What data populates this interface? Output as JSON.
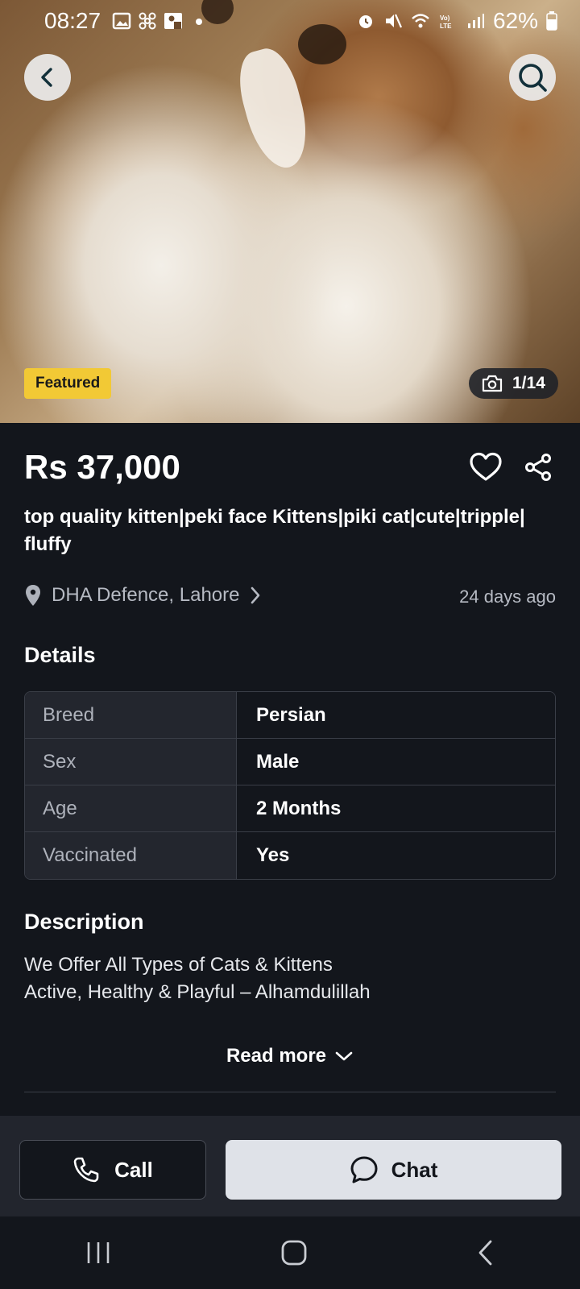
{
  "status_bar": {
    "time": "08:27",
    "battery": "62%"
  },
  "hero": {
    "featured_label": "Featured",
    "photo_count": "1/14"
  },
  "listing": {
    "price": "Rs 37,000",
    "title": "top quality kitten|peki face Kittens|piki cat|cute|tripple| fluffy",
    "location": "DHA Defence, Lahore",
    "posted": "24 days ago"
  },
  "details": {
    "heading": "Details",
    "rows": [
      {
        "key": "Breed",
        "value": "Persian"
      },
      {
        "key": "Sex",
        "value": "Male"
      },
      {
        "key": "Age",
        "value": "2 Months"
      },
      {
        "key": "Vaccinated",
        "value": "Yes"
      }
    ]
  },
  "description": {
    "heading": "Description",
    "line1": "We Offer All Types of Cats & Kittens",
    "line2": "Active, Healthy & Playful – Alhamdulillah",
    "read_more": "Read more"
  },
  "actions": {
    "call_label": "Call",
    "chat_label": "Chat"
  },
  "icons": [
    "back-icon",
    "search-icon",
    "camera-icon",
    "heart-icon",
    "share-icon",
    "location-pin-icon",
    "chevron-right-icon",
    "chevron-down-icon",
    "phone-icon",
    "chat-bubble-icon",
    "recents-icon",
    "home-icon",
    "back-nav-icon"
  ],
  "colors": {
    "featured_badge": "#f2c935",
    "background": "#13161c",
    "chat_button": "#dfe2e8"
  }
}
